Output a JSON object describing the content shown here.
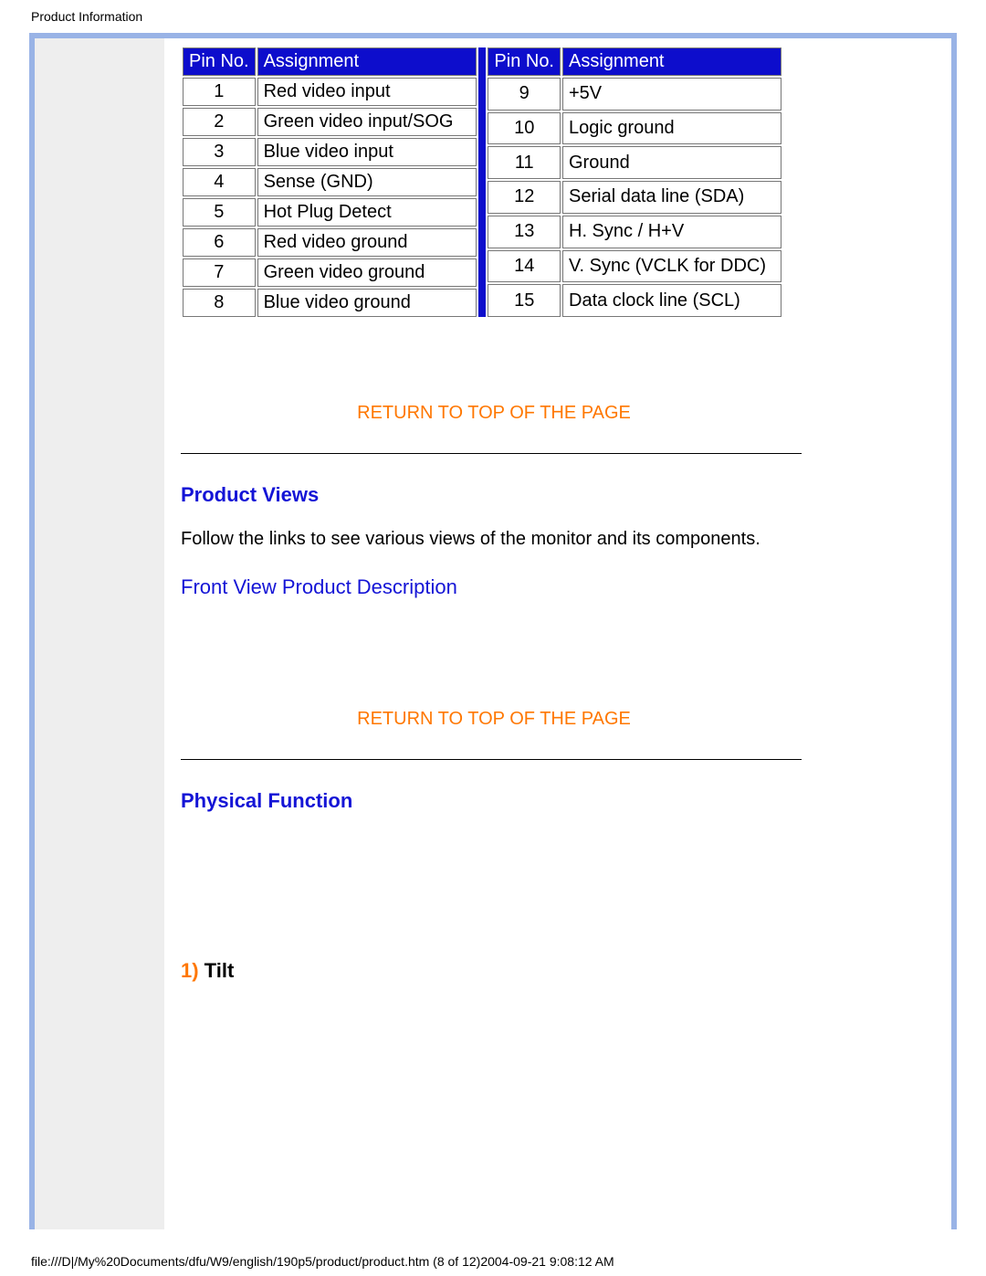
{
  "header": "Product Information",
  "table_left": {
    "head_pin": "Pin No.",
    "head_assign": "Assignment",
    "rows": [
      {
        "no": "1",
        "assign": "Red video input"
      },
      {
        "no": "2",
        "assign": "Green video input/SOG"
      },
      {
        "no": "3",
        "assign": "Blue video input"
      },
      {
        "no": "4",
        "assign": "Sense (GND)"
      },
      {
        "no": "5",
        "assign": "Hot Plug Detect"
      },
      {
        "no": "6",
        "assign": "Red video ground"
      },
      {
        "no": "7",
        "assign": "Green video ground"
      },
      {
        "no": "8",
        "assign": "Blue video ground"
      }
    ]
  },
  "table_right": {
    "head_pin": "Pin No.",
    "head_assign": "Assignment",
    "rows": [
      {
        "no": "9",
        "assign": "+5V"
      },
      {
        "no": "10",
        "assign": "Logic ground"
      },
      {
        "no": "11",
        "assign": "Ground"
      },
      {
        "no": "12",
        "assign": "Serial data line (SDA)"
      },
      {
        "no": "13",
        "assign": "H. Sync / H+V"
      },
      {
        "no": "14",
        "assign": "V. Sync (VCLK for DDC)"
      },
      {
        "no": "15",
        "assign": "Data clock line (SCL)"
      }
    ]
  },
  "return_link": "RETURN TO TOP OF THE PAGE",
  "section_views": "Product Views",
  "views_body": "Follow the links to see various views of the monitor and its components.",
  "front_link": "Front View Product Description",
  "section_phys": "Physical Function",
  "tilt_num": "1)",
  "tilt_txt": " Tilt",
  "footer": "file:///D|/My%20Documents/dfu/W9/english/190p5/product/product.htm (8 of 12)2004-09-21 9:08:12 AM"
}
